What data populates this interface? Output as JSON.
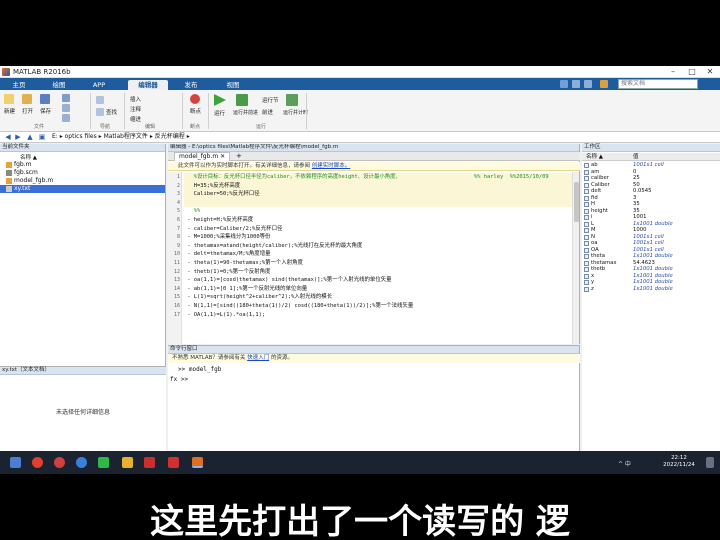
{
  "window": {
    "title": "MATLAB R2016b"
  },
  "tabs": [
    {
      "label": "主页",
      "active": false
    },
    {
      "label": "绘图",
      "active": false
    },
    {
      "label": "APP",
      "active": false
    },
    {
      "label": "编辑器",
      "active": true
    },
    {
      "label": "发布",
      "active": false
    },
    {
      "label": "视图",
      "active": false
    }
  ],
  "search": {
    "placeholder": "搜索文档"
  },
  "ribbon": {
    "new": "新建",
    "open": "打开",
    "save": "保存",
    "find": "查找",
    "insert": "插入",
    "comment": "注释",
    "indent": "缩进",
    "breakpoint": "断点",
    "run": "运行",
    "run_advance": "运行并前进",
    "run_section": "运行节",
    "advance": "前进",
    "run_time": "运行并计时",
    "group_file": "文件",
    "group_navigate": "导航",
    "group_edit": "编辑",
    "group_breakpoints": "断点",
    "group_run": "运行"
  },
  "address": {
    "path": [
      "E:",
      "optics files",
      "Matlab程序文件",
      "反光杯编程"
    ]
  },
  "left_panel": {
    "header": "当前文件夹",
    "column_name": "名称 ▲",
    "files": [
      {
        "name": "fgb.m",
        "selected": false,
        "icon_color": "#e8a23a"
      },
      {
        "name": "fgb.scm",
        "selected": false,
        "icon_color": "#888888"
      },
      {
        "name": "model_fgb.m",
        "selected": false,
        "icon_color": "#e8a23a"
      },
      {
        "name": "xy.txt",
        "selected": true,
        "icon_color": "#cccccc"
      }
    ],
    "detail_header": "xy.txt（文本文档）",
    "detail_text": "未选择任何详细信息"
  },
  "editor": {
    "header": "编辑器 - E:\\optics files\\Matlab程序文件\\反光杯编程\\model_fgb.m",
    "tab": "model_fgb.m",
    "info": "此文件可以作为实时脚本打开。有关详细信息，请参阅",
    "info_link": "创建实时脚本。",
    "lines": [
      {
        "n": "1",
        "text": "   %设计目标：反光杯口径半径为caliber，不依赖程序的高度height、设计最小角度、",
        "cls": "code-cmt code-hl",
        "tail": "%% harley  %%2015/10/09"
      },
      {
        "n": "2",
        "text": "   H=35;%反光杯高度",
        "cls": "code-hl",
        "tail": ""
      },
      {
        "n": "3",
        "text": "   Caliber=50;%反光杯口径",
        "cls": "code-hl",
        "tail": ""
      },
      {
        "n": "4",
        "text": "",
        "cls": "code-hl",
        "tail": ""
      },
      {
        "n": "5",
        "text": "   %%",
        "cls": "code-cmt",
        "tail": ""
      },
      {
        "n": "6",
        "text": " - height=H;%反光杯高度",
        "cls": "",
        "tail": ""
      },
      {
        "n": "7",
        "text": " - caliber=Caliber/2;%反光杯口径",
        "cls": "",
        "tail": ""
      },
      {
        "n": "8",
        "text": " - M=1000;%采集线分为1000等份",
        "cls": "",
        "tail": ""
      },
      {
        "n": "9",
        "text": " - thetamax=atand(height/caliber);%光线打在反光杯的最大角度",
        "cls": "",
        "tail": ""
      },
      {
        "n": "10",
        "text": " - delt=thetamax/M;%角度增量",
        "cls": "",
        "tail": ""
      },
      {
        "n": "11",
        "text": " - theta(1)=90-thetamax;%第一个入射角度",
        "cls": "",
        "tail": ""
      },
      {
        "n": "12",
        "text": " - thetb(1)=0;%第一个反射角度",
        "cls": "",
        "tail": ""
      },
      {
        "n": "13",
        "text": " - oa(1,1)=[cosd(thetamax) sind(thetamax)];%第一个入射光线的单位矢量",
        "cls": "",
        "tail": ""
      },
      {
        "n": "14",
        "text": " - ab(1,1)=[0 1];%第一个反射光线的单位向量",
        "cls": "",
        "tail": ""
      },
      {
        "n": "15",
        "text": " - L(1)=sqrt(height^2+caliber^2);%入射光线的模长",
        "cls": "",
        "tail": ""
      },
      {
        "n": "16",
        "text": " - N(1,1)=[sind((180+theta(1))/2) cosd((180+theta(1))/2)];%第一个法线矢量",
        "cls": "",
        "tail": ""
      },
      {
        "n": "17",
        "text": " - OA(1,1)=L(1).*oa(1,1);",
        "cls": "",
        "tail": ""
      }
    ]
  },
  "command_window": {
    "header": "命令行窗口",
    "info": "不熟悉 MATLAB？请参阅有关",
    "info_link": "快速入门",
    "info_tail": "的资源。",
    "history_prompt": ">>",
    "history_cmd": "model_fgb",
    "current_prompt": "fx >>"
  },
  "workspace": {
    "header": "工作区",
    "col_name": "名称 ▲",
    "col_value": "值",
    "rows": [
      {
        "name": "ab",
        "value": "1001x1 cell",
        "italic": true
      },
      {
        "name": "am",
        "value": "0",
        "italic": false
      },
      {
        "name": "caliber",
        "value": "25",
        "italic": false
      },
      {
        "name": "Caliber",
        "value": "50",
        "italic": false
      },
      {
        "name": "delt",
        "value": "0.0545",
        "italic": false
      },
      {
        "name": "fid",
        "value": "3",
        "italic": false
      },
      {
        "name": "H",
        "value": "35",
        "italic": false
      },
      {
        "name": "height",
        "value": "35",
        "italic": false
      },
      {
        "name": "i",
        "value": "1001",
        "italic": false
      },
      {
        "name": "L",
        "value": "1x1001 double",
        "italic": true
      },
      {
        "name": "M",
        "value": "1000",
        "italic": false
      },
      {
        "name": "N",
        "value": "1001x1 cell",
        "italic": true
      },
      {
        "name": "oa",
        "value": "1001x1 cell",
        "italic": true
      },
      {
        "name": "OA",
        "value": "1001x1 cell",
        "italic": true
      },
      {
        "name": "theta",
        "value": "1x1001 double",
        "italic": true
      },
      {
        "name": "thetamax",
        "value": "54.4623",
        "italic": false
      },
      {
        "name": "thetb",
        "value": "1x1001 double",
        "italic": true
      },
      {
        "name": "x",
        "value": "1x1001 double",
        "italic": true
      },
      {
        "name": "y",
        "value": "1x1001 double",
        "italic": true
      },
      {
        "name": "z",
        "value": "1x1001 double",
        "italic": true
      }
    ]
  },
  "taskbar": {
    "time": "22:12",
    "date": "2022/11/24",
    "tray": "^  中"
  },
  "subtitle": "这里先打出了一个读写的    逻"
}
